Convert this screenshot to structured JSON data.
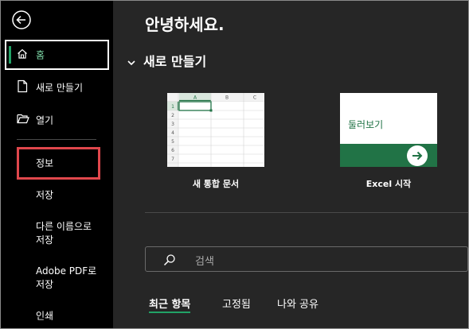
{
  "sidebar": {
    "home_label": "홈",
    "new_label": "새로 만들기",
    "open_label": "열기",
    "info_label": "정보",
    "save_label": "저장",
    "save_as_label": "다른 이름으로\n저장",
    "save_as_line1": "다른 이름으로",
    "save_as_line2": "저장",
    "adobe_line1": "Adobe PDF로",
    "adobe_line2": "저장",
    "print_label": "인쇄"
  },
  "main": {
    "greeting": "안녕하세요.",
    "new_section_title": "새로 만들기",
    "templates": [
      {
        "caption": "새 통합 문서"
      },
      {
        "caption": "Excel 시작",
        "tile_text": "둘러보기"
      }
    ],
    "grid": {
      "columns": [
        "A",
        "B",
        "C"
      ],
      "rows": [
        "1",
        "2",
        "3",
        "4",
        "5",
        "6",
        "7"
      ]
    },
    "search_placeholder": "검색",
    "tabs": [
      "최근 항목",
      "고정됨",
      "나와 공유"
    ]
  },
  "colors": {
    "accent_green": "#21a366",
    "excel_green": "#217346",
    "highlight_red": "#e0474c"
  },
  "icons": [
    "back-arrow-icon",
    "home-icon",
    "new-file-icon",
    "folder-open-icon",
    "search-icon",
    "arrow-right-icon"
  ]
}
